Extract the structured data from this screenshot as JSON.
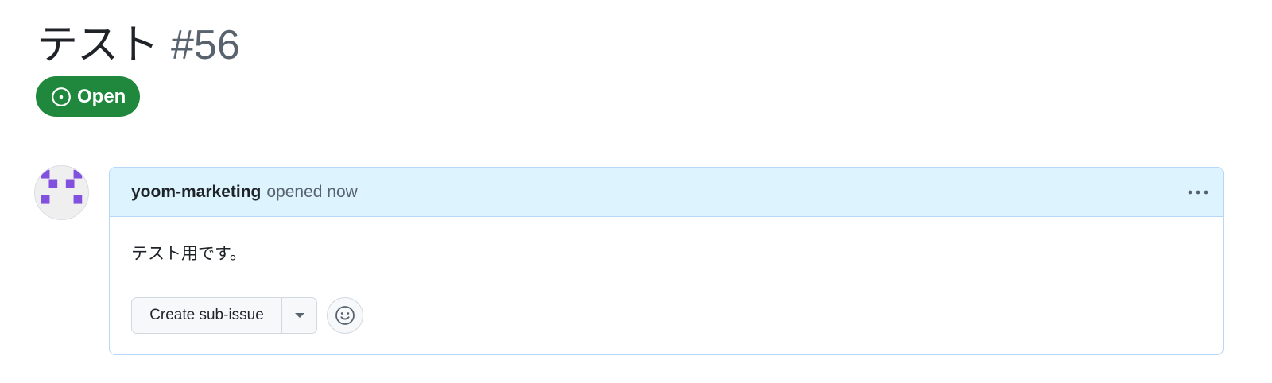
{
  "issue": {
    "title": "テスト",
    "number": "#56",
    "state": "Open"
  },
  "comment": {
    "author": "yoom-marketing",
    "timestamp": "opened now",
    "body": "テスト用です。",
    "menu_icon": "kebab-horizontal-icon",
    "create_sub_issue_label": "Create sub-issue",
    "dropdown_icon": "triangle-down-icon",
    "reaction_icon": "smiley-icon"
  },
  "colors": {
    "open_state": "#1f883d",
    "header_bg": "#ddf4ff",
    "header_border": "#b6d7f7",
    "avatar_pixels": "#8250df",
    "muted_text": "#59636e"
  }
}
